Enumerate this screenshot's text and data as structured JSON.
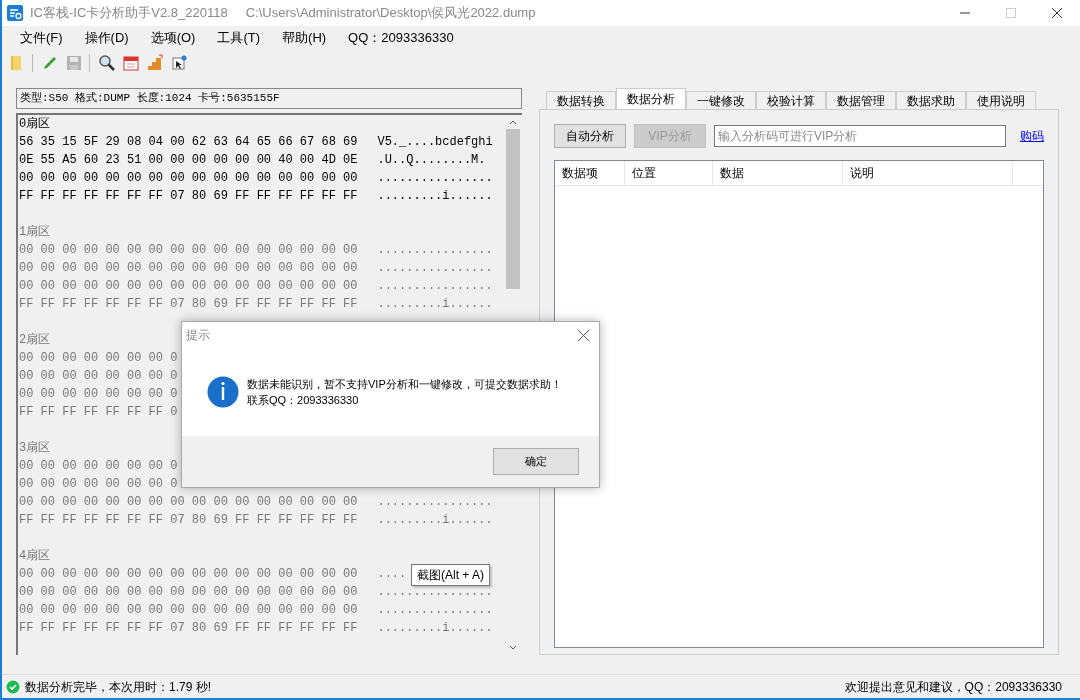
{
  "window": {
    "title": "IC客栈-IC卡分析助手V2.8_220118",
    "file_path": "C:\\Users\\Administrator\\Desktop\\侯风光2022.dump"
  },
  "menu": [
    "文件(F)",
    "操作(D)",
    "选项(O)",
    "工具(T)",
    "帮助(H)"
  ],
  "menu_qq": "QQ：2093336330",
  "toolbar": [
    [
      {
        "kind": "folder",
        "disabled": false
      }
    ],
    [
      {
        "kind": "pencil",
        "disabled": false
      },
      {
        "kind": "save",
        "disabled": true
      }
    ],
    [
      {
        "kind": "magnifier",
        "disabled": false
      },
      {
        "kind": "calendar",
        "disabled": false
      },
      {
        "kind": "chart",
        "disabled": false
      },
      {
        "kind": "pointer",
        "disabled": false
      }
    ]
  ],
  "card_info": "类型:S50 格式:DUMP 长度:1024 卡号:5635155F",
  "sectors": [
    {
      "label": "0扇区",
      "highlighted": true,
      "rows": [
        {
          "hex": "56 35 15 5F 29 08 04 00 62 63 64 65 66 67 68 69",
          "ascii": "V5._....bcdefghi"
        },
        {
          "hex": "0E 55 A5 60 23 51 00 00 00 00 00 00 40 00 4D 0E",
          "ascii": ".U..Q........M."
        },
        {
          "hex": "00 00 00 00 00 00 00 00 00 00 00 00 00 00 00 00",
          "ascii": "................"
        },
        {
          "hex": "FF FF FF FF FF FF FF 07 80 69 FF FF FF FF FF FF",
          "ascii": ".........i......"
        }
      ]
    },
    {
      "label": "1扇区",
      "highlighted": false,
      "rows": [
        {
          "hex": "00 00 00 00 00 00 00 00 00 00 00 00 00 00 00 00",
          "ascii": "................"
        },
        {
          "hex": "00 00 00 00 00 00 00 00 00 00 00 00 00 00 00 00",
          "ascii": "................"
        },
        {
          "hex": "00 00 00 00 00 00 00 00 00 00 00 00 00 00 00 00",
          "ascii": "................"
        },
        {
          "hex": "FF FF FF FF FF FF FF 07 80 69 FF FF FF FF FF FF",
          "ascii": ".........i......"
        }
      ]
    },
    {
      "label": "2扇区",
      "highlighted": false,
      "rows": [
        {
          "hex": "00 00 00 00 00 00 00 0"
        },
        {
          "hex": "00 00 00 00 00 00 00 0"
        },
        {
          "hex": "00 00 00 00 00 00 00 0"
        },
        {
          "hex": "FF FF FF FF FF FF FF 0"
        }
      ]
    },
    {
      "label": "3扇区",
      "highlighted": false,
      "rows": [
        {
          "hex": "00 00 00 00 00 00 00 0"
        },
        {
          "hex": "00 00 00 00 00 00 00 0"
        },
        {
          "hex": "00 00 00 00 00 00 00 00 00 00 00 00 00 00 00 00",
          "ascii": "................"
        },
        {
          "hex": "FF FF FF FF FF FF FF 07 80 69 FF FF FF FF FF FF",
          "ascii": ".........i......"
        }
      ]
    },
    {
      "label": "4扇区",
      "highlighted": false,
      "rows": [
        {
          "hex": "00 00 00 00 00 00 00 00 00 00 00 00 00 00 00 00",
          "ascii": "...."
        },
        {
          "hex": "00 00 00 00 00 00 00 00 00 00 00 00 00 00 00 00",
          "ascii": "................"
        },
        {
          "hex": "00 00 00 00 00 00 00 00 00 00 00 00 00 00 00 00",
          "ascii": "................"
        },
        {
          "hex": "FF FF FF FF FF FF FF 07 80 69 FF FF FF FF FF FF",
          "ascii": ".........i......"
        }
      ]
    }
  ],
  "tabs": [
    {
      "label": "数据转换",
      "selected": false
    },
    {
      "label": "数据分析",
      "selected": true
    },
    {
      "label": "一键修改",
      "selected": false
    },
    {
      "label": "校验计算",
      "selected": false
    },
    {
      "label": "数据管理",
      "selected": false
    },
    {
      "label": "数据求助",
      "selected": false
    },
    {
      "label": "使用说明",
      "selected": false
    }
  ],
  "analysis": {
    "buttons": [
      {
        "label": "自动分析",
        "disabled": false
      },
      {
        "label": "VIP分析",
        "disabled": true
      }
    ],
    "code_field": {
      "placeholder": "输入分析码可进行VIP分析"
    },
    "link": "购码",
    "columns": [
      "数据项",
      "位置",
      "数据",
      "说明"
    ]
  },
  "dialog": {
    "title": "提示",
    "message": [
      "数据未能识别，暂不支持VIP分析和一键修改，可提交数据求助！",
      "联系QQ：2093336330"
    ],
    "button": "确定"
  },
  "tooltip": "截图(Alt + A)",
  "status_bar": {
    "message": "数据分析完毕，本次用时：1.79 秒!",
    "right": "欢迎提出意见和建议，QQ：2093336330"
  }
}
